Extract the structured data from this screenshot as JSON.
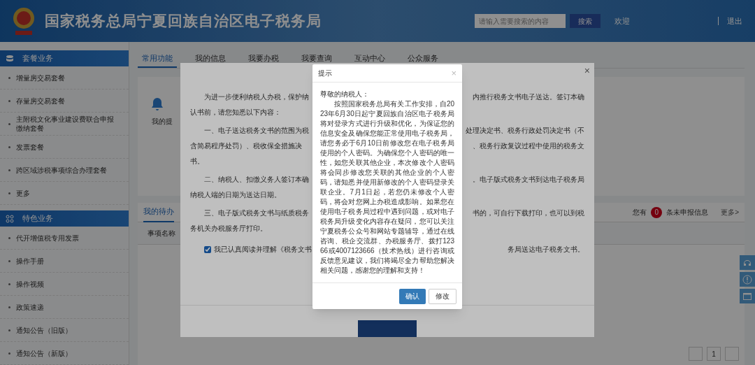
{
  "header": {
    "title": "国家税务总局宁夏回族自治区电子税务局",
    "search": {
      "placeholder": "请输入需要搜索的内容"
    },
    "search_button": "搜索",
    "welcome": "欢迎",
    "logout": "退出"
  },
  "sidebar": {
    "sections": [
      {
        "title": "套餐业务",
        "kind": "stack",
        "items": [
          "增量房交易套餐",
          "存量房交易套餐",
          "主附税文化事业建设费联合申报缴纳套餐",
          "发票套餐",
          "跨区域涉税事项综合办理套餐",
          "更多"
        ]
      },
      {
        "title": "特色业务",
        "kind": "grid",
        "items": [
          "代开增值税专用发票",
          "操作手册",
          "操作视频",
          "政策速递",
          "通知公告（旧版）",
          "通知公告（新版）"
        ]
      }
    ]
  },
  "tabs": [
    {
      "label": "常用功能",
      "selected": true
    },
    {
      "label": "我的信息",
      "selected": false
    },
    {
      "label": "我要办税",
      "selected": false
    },
    {
      "label": "我要查询",
      "selected": false
    },
    {
      "label": "互动中心",
      "selected": false
    },
    {
      "label": "公众服务",
      "selected": false
    }
  ],
  "reminder": {
    "label": "我的提"
  },
  "todo": {
    "tab": "我的待办",
    "column": "事项名称",
    "notice_prefix": "您有",
    "count": "0",
    "notice_suffix": "条未申报信息",
    "more": "更多>"
  },
  "pagination": {
    "pages": [
      {
        "label": "1",
        "selected": false
      }
    ]
  },
  "agreement_modal": {
    "close": "×",
    "lines": [
      {
        "kind": "start",
        "left": "为进一步便利纳税人办税，保护纳",
        "right": "内推行税务文书电子送达。签订本确"
      },
      {
        "kind": "continue",
        "left": "认书前，请您知悉以下内容："
      },
      {
        "kind": "start",
        "left": "一、电子送达税务文书的范围为税",
        "right": "处理决定书、税务行政处罚决定书（不"
      },
      {
        "kind": "continue",
        "left": "含简易程序处罚）、税收保全措施决",
        "right": "、税务行政复议过程中使用的税务文"
      },
      {
        "kind": "continue",
        "left": "书。"
      },
      {
        "kind": "start",
        "left": "二、纳税人、扣缴义务人签订本确",
        "right": "。电子版式税务文书到达电子税务局"
      },
      {
        "kind": "continue",
        "left": "纳税人端的日期为送达日期。"
      },
      {
        "kind": "start",
        "left": "三、电子版式税务文书与纸质税务",
        "right": "书的，可自行下载打印，也可以到税"
      },
      {
        "kind": "continue",
        "left": "务机关办税服务厅打印。"
      }
    ],
    "checkbox": {
      "checked": true,
      "left": "我已认真阅读并理解《税务文书",
      "right": "务局送达电子税务文书。"
    }
  },
  "dialog": {
    "title": "提示",
    "close": "×",
    "greeting": "尊敬的纳税人：",
    "body": "按照国家税务总局有关工作安排，自2023年6月30日起宁夏回族自治区电子税务局将对登录方式进行升级和优化，为保证您的信息安全及确保您能正常使用电子税务局，请您务必于6月10日前修改您在电子税务局使用的个人密码。为确保您个人密码的唯一性，如您关联其他企业，本次修改个人密码将会同步修改您关联的其他企业的个人密码，请知悉并使用新修改的个人密码登录关联企业。7月1日起，若您仍未修改个人密码，将会对您网上办税造成影响。如果您在使用电子税务局过程中遇到问题，或对电子税务局升级变化内容存在疑问，您可以关注宁夏税务公众号和网站专题辅导，通过在线咨询、税企交流群、办税服务厅、拨打12366或4007123666（技术热线）进行咨询或反馈意见建议，我们将竭尽全力帮助您解决相关问题，感谢您的理解和支持！",
    "buttons": [
      {
        "label": "确认",
        "kind": "primary"
      },
      {
        "label": "修改",
        "kind": "default"
      }
    ]
  }
}
